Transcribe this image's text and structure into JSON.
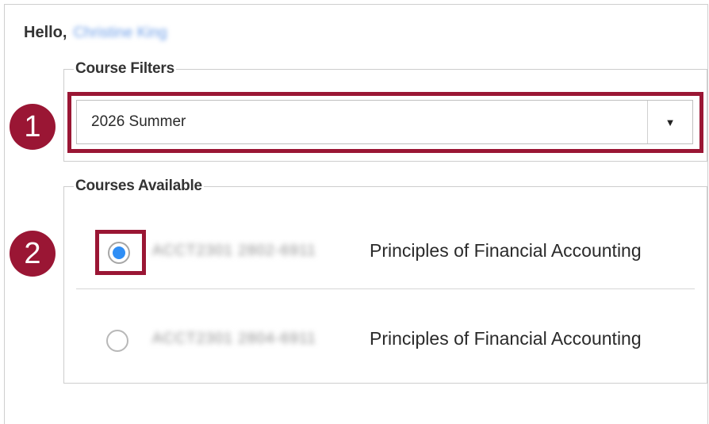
{
  "greeting": {
    "hello": "Hello,",
    "user_name": "Christine King"
  },
  "filters": {
    "legend": "Course Filters",
    "selected_term": "2026 Summer",
    "arrow": "▼"
  },
  "courses": {
    "legend": "Courses Available",
    "items": [
      {
        "code": "ACCT2301 2802-6911",
        "title": "Principles of Financial Accounting",
        "selected": true
      },
      {
        "code": "ACCT2301 2804-6911",
        "title": "Principles of Financial Accounting",
        "selected": false
      }
    ]
  },
  "callouts": {
    "first": "1",
    "second": "2"
  },
  "colors": {
    "accent": "#9a1634",
    "radio_selected": "#2f8ef5"
  }
}
